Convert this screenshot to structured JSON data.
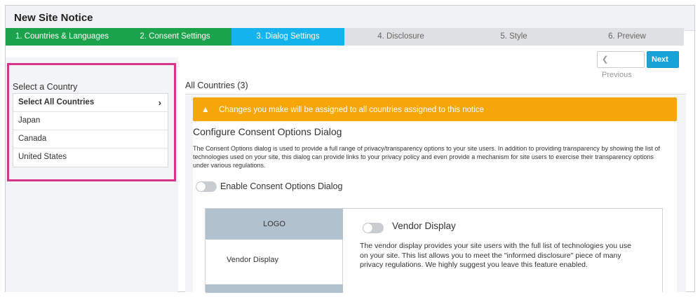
{
  "header": {
    "title": "New Site Notice"
  },
  "steps": [
    {
      "label": "1. Countries & Languages",
      "state": "done"
    },
    {
      "label": "2. Consent Settings",
      "state": "done"
    },
    {
      "label": "3. Dialog Settings",
      "state": "active"
    },
    {
      "label": "4. Disclosure",
      "state": "todo"
    },
    {
      "label": "5. Style",
      "state": "todo"
    },
    {
      "label": "6. Preview",
      "state": "todo"
    }
  ],
  "nav": {
    "previous_label": "Previous",
    "next_label": "Next"
  },
  "sidebar": {
    "label": "Select a Country",
    "items": [
      "Select All Countries",
      "Japan",
      "Canada",
      "United States"
    ]
  },
  "main": {
    "heading": "All Countries (3)",
    "warning": "Changes you make will be assigned to all countries assigned to this notice",
    "section_title": "Configure Consent Options Dialog",
    "description": "The Consent Options dialog is used to provide a full range of privacy/transparency options to your site users. In addition to providing transparency by showing the list of technologies used on your site, this dialog can provide links to your privacy policy and even provide a mechanism for site users to exercise their transparency options under various regulations.",
    "enable_toggle_label": "Enable Consent Options Dialog",
    "enable_toggle_on": false
  },
  "preview": {
    "logo": "LOGO",
    "side_item": "Vendor Display",
    "vendor_title": "Vendor Display",
    "vendor_toggle_on": false,
    "vendor_desc": "The vendor display provides your site users with the full list of technologies you use on your site. This list allows you to meet the \"informed disclosure\" piece of many privacy regulations. We highly suggest you leave this feature enabled."
  },
  "colors": {
    "step_done": "#1aa34a",
    "step_active": "#15b3ec",
    "step_todo": "#dfe0e2",
    "warning": "#f6a609",
    "highlight": "#d6348a",
    "next_button": "#17a2d8"
  }
}
